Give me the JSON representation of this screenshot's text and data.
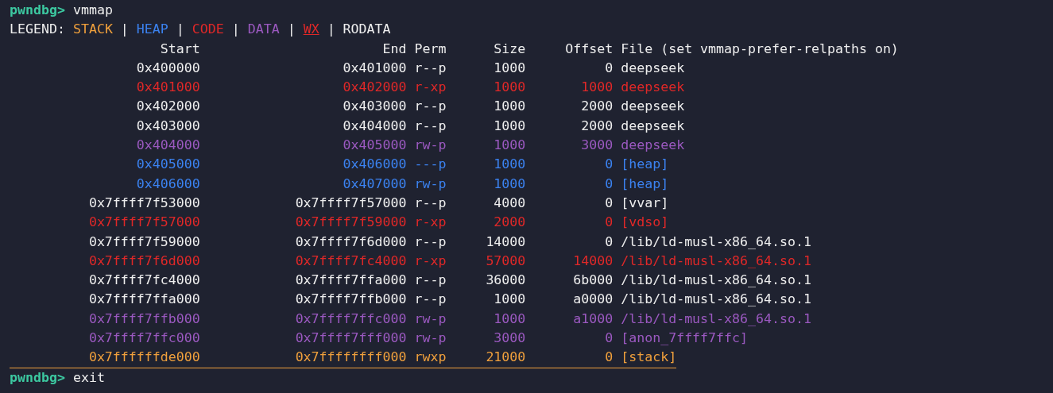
{
  "commands": [
    {
      "prompt": "pwndbg>",
      "command": "vmmap"
    }
  ],
  "legend": {
    "label": "LEGEND:",
    "items": [
      {
        "kind": "stack",
        "text": "STACK"
      },
      {
        "kind": "heap",
        "text": "HEAP"
      },
      {
        "kind": "code",
        "text": "CODE"
      },
      {
        "kind": "data",
        "text": "DATA"
      },
      {
        "kind": "wx",
        "text": "WX"
      },
      {
        "kind": "rodata",
        "text": "RODATA"
      }
    ],
    "separator": "|"
  },
  "table": {
    "columns": [
      "Start",
      "End",
      "Perm",
      "Size",
      "Offset",
      "File (set vmmap-prefer-relpaths on)"
    ],
    "rows": [
      {
        "kind": "rodata",
        "cells": [
          "0x400000",
          "0x401000",
          "r--p",
          "1000",
          "0",
          "deepseek"
        ]
      },
      {
        "kind": "code",
        "cells": [
          "0x401000",
          "0x402000",
          "r-xp",
          "1000",
          "1000",
          "deepseek"
        ]
      },
      {
        "kind": "rodata",
        "cells": [
          "0x402000",
          "0x403000",
          "r--p",
          "1000",
          "2000",
          "deepseek"
        ]
      },
      {
        "kind": "rodata",
        "cells": [
          "0x403000",
          "0x404000",
          "r--p",
          "1000",
          "2000",
          "deepseek"
        ]
      },
      {
        "kind": "data",
        "cells": [
          "0x404000",
          "0x405000",
          "rw-p",
          "1000",
          "3000",
          "deepseek"
        ]
      },
      {
        "kind": "heap",
        "cells": [
          "0x405000",
          "0x406000",
          "---p",
          "1000",
          "0",
          "[heap]"
        ]
      },
      {
        "kind": "heap",
        "cells": [
          "0x406000",
          "0x407000",
          "rw-p",
          "1000",
          "0",
          "[heap]"
        ]
      },
      {
        "kind": "rodata",
        "cells": [
          "0x7ffff7f53000",
          "0x7ffff7f57000",
          "r--p",
          "4000",
          "0",
          "[vvar]"
        ]
      },
      {
        "kind": "code",
        "cells": [
          "0x7ffff7f57000",
          "0x7ffff7f59000",
          "r-xp",
          "2000",
          "0",
          "[vdso]"
        ]
      },
      {
        "kind": "rodata",
        "cells": [
          "0x7ffff7f59000",
          "0x7ffff7f6d000",
          "r--p",
          "14000",
          "0",
          "/lib/ld-musl-x86_64.so.1"
        ]
      },
      {
        "kind": "code",
        "cells": [
          "0x7ffff7f6d000",
          "0x7ffff7fc4000",
          "r-xp",
          "57000",
          "14000",
          "/lib/ld-musl-x86_64.so.1"
        ]
      },
      {
        "kind": "rodata",
        "cells": [
          "0x7ffff7fc4000",
          "0x7ffff7ffa000",
          "r--p",
          "36000",
          "6b000",
          "/lib/ld-musl-x86_64.so.1"
        ]
      },
      {
        "kind": "rodata",
        "cells": [
          "0x7ffff7ffa000",
          "0x7ffff7ffb000",
          "r--p",
          "1000",
          "a0000",
          "/lib/ld-musl-x86_64.so.1"
        ]
      },
      {
        "kind": "data",
        "cells": [
          "0x7ffff7ffb000",
          "0x7ffff7ffc000",
          "rw-p",
          "1000",
          "a1000",
          "/lib/ld-musl-x86_64.so.1"
        ]
      },
      {
        "kind": "data",
        "cells": [
          "0x7ffff7ffc000",
          "0x7ffff7fff000",
          "rw-p",
          "3000",
          "0",
          "[anon_7ffff7ffc]"
        ]
      },
      {
        "kind": "stack",
        "cells": [
          "0x7ffffffde000",
          "0x7ffffffff000",
          "rwxp",
          "21000",
          "0",
          "[stack]"
        ]
      }
    ]
  },
  "next_command": {
    "prompt": "pwndbg>",
    "command": "exit"
  }
}
